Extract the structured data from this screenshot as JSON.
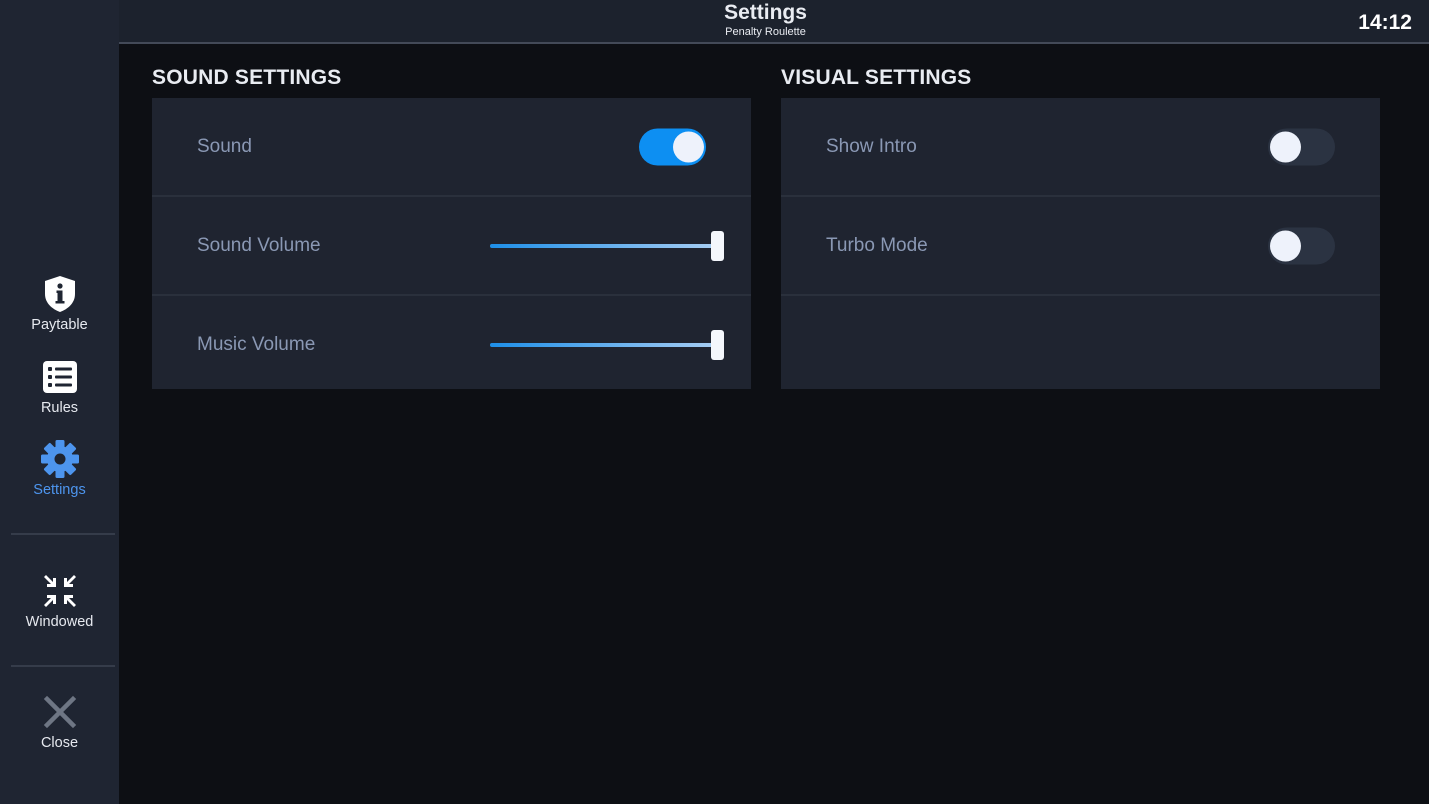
{
  "header": {
    "title": "Settings",
    "subtitle": "Penalty Roulette",
    "clock": "14:12"
  },
  "sidebar": {
    "items": [
      {
        "label": "Paytable",
        "icon": "shield-info-icon",
        "active": false
      },
      {
        "label": "Rules",
        "icon": "list-icon",
        "active": false
      },
      {
        "label": "Settings",
        "icon": "gear-icon",
        "active": true
      },
      {
        "label": "Windowed",
        "icon": "minimize-arrows-icon",
        "active": false
      },
      {
        "label": "Close",
        "icon": "close-icon",
        "active": false
      }
    ]
  },
  "sound_settings": {
    "title": "SOUND SETTINGS",
    "sound": {
      "label": "Sound",
      "enabled": true
    },
    "sound_volume": {
      "label": "Sound Volume",
      "value": 1.0
    },
    "music_volume": {
      "label": "Music Volume",
      "value": 1.0
    }
  },
  "visual_settings": {
    "title": "VISUAL SETTINGS",
    "show_intro": {
      "label": "Show Intro",
      "enabled": false
    },
    "turbo_mode": {
      "label": "Turbo Mode",
      "enabled": false
    }
  },
  "colors": {
    "accent": "#0d8ff2",
    "active_nav": "#4d95ee",
    "sidebar_bg": "#1f2532",
    "panel_bg": "#1f2430",
    "page_bg": "#0d0f14"
  }
}
